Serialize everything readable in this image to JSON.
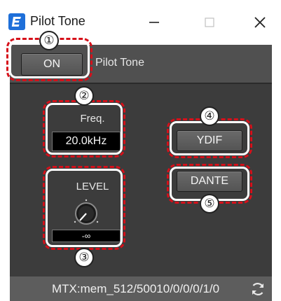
{
  "window": {
    "title": "Pilot Tone",
    "icon": "app-logo-icon",
    "controls": [
      "minimize-icon",
      "maximize-icon",
      "close-icon"
    ]
  },
  "header": {
    "on_button": "ON",
    "label": "Pilot Tone"
  },
  "frequency": {
    "label": "Freq.",
    "value": "20.0kHz"
  },
  "level": {
    "label": "LEVEL",
    "value": "-∞"
  },
  "outputs": {
    "ydif_button": "YDIF",
    "dante_button": "DANTE"
  },
  "status": {
    "address": "MTX:mem_512/50010/0/0/0/1/0",
    "refresh_icon": "refresh-icon"
  },
  "callouts": [
    "①",
    "②",
    "③",
    "④",
    "⑤"
  ],
  "colors": {
    "panel": "#3c3c3c",
    "callout": "#d6101a",
    "app_icon": "#1e6fd9"
  }
}
